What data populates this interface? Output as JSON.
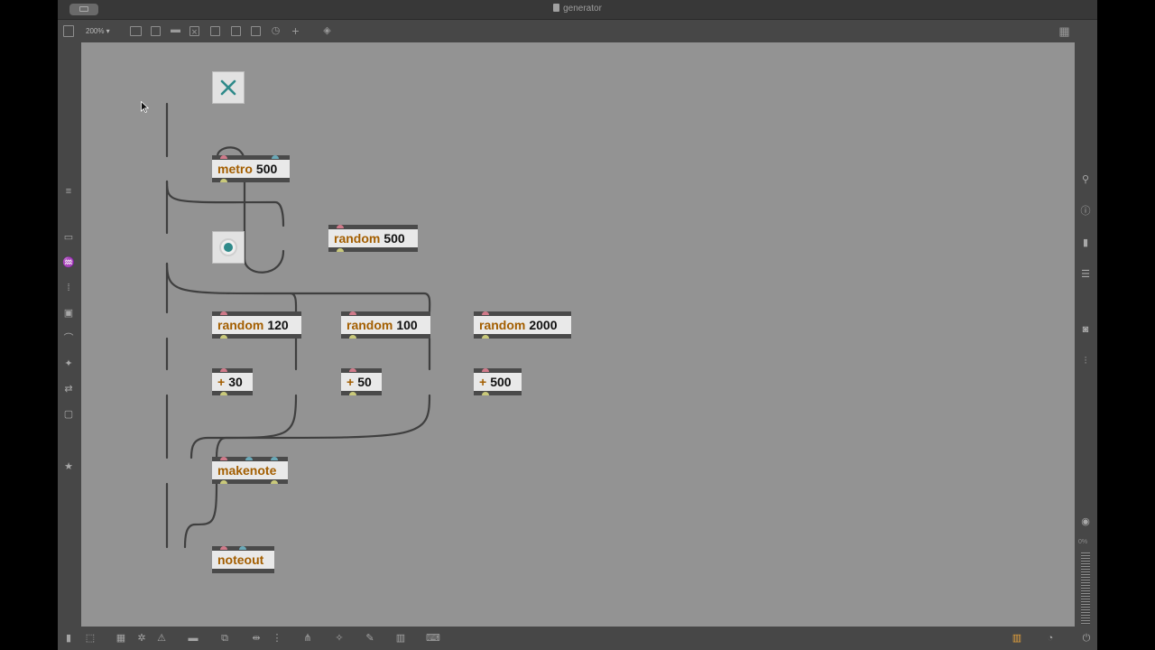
{
  "window": {
    "title": "generator",
    "zoom_label": "200% ▾"
  },
  "colors": {
    "canvas": "#939393",
    "class_text": "#a35e00",
    "toggle_accent": "#2f8a8a",
    "wire": "#3f3f3f"
  },
  "toolbar": {
    "icons": [
      "sidebar-icon",
      "presentation-icon",
      "comment-icon",
      "message-icon",
      "toggle-icon",
      "number-icon",
      "button-icon",
      "slider-icon",
      "dial-icon",
      "add-icon",
      "paint-bucket-icon",
      "grid-icon"
    ]
  },
  "patch": {
    "toggle": {
      "name": "toggle",
      "state": "on"
    },
    "bang": {
      "name": "button"
    },
    "objects": [
      {
        "id": "metro",
        "cls": "metro",
        "arg": "500"
      },
      {
        "id": "random500",
        "cls": "random",
        "arg": "500"
      },
      {
        "id": "random120",
        "cls": "random",
        "arg": "120"
      },
      {
        "id": "random100",
        "cls": "random",
        "arg": "100"
      },
      {
        "id": "random2000",
        "cls": "random",
        "arg": "2000"
      },
      {
        "id": "plus30",
        "cls": "+",
        "arg": "30"
      },
      {
        "id": "plus50",
        "cls": "+",
        "arg": "50"
      },
      {
        "id": "plus500",
        "cls": "+",
        "arg": "500"
      },
      {
        "id": "makenote",
        "cls": "makenote",
        "arg": ""
      },
      {
        "id": "noteout",
        "cls": "noteout",
        "arg": ""
      }
    ]
  },
  "right_sidebar": {
    "meter_label": "0%"
  }
}
